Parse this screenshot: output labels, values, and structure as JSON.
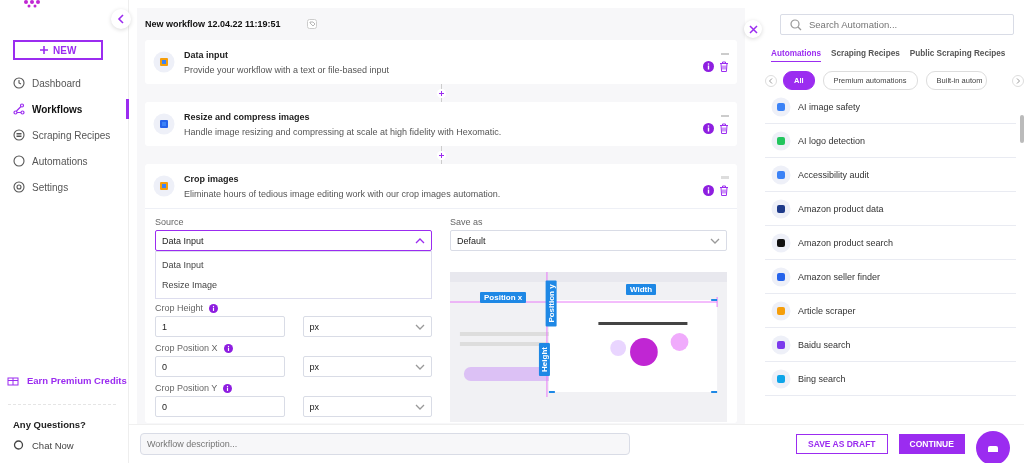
{
  "sidebar": {
    "new_button": "NEW",
    "nav": [
      {
        "label": "Dashboard",
        "selected": false
      },
      {
        "label": "Workflows",
        "selected": true
      },
      {
        "label": "Scraping Recipes",
        "selected": false
      },
      {
        "label": "Automations",
        "selected": false
      },
      {
        "label": "Settings",
        "selected": false
      }
    ],
    "earn_credits": "Earn Premium Credits",
    "questions_title": "Any Questions?",
    "chat_now": "Chat Now"
  },
  "workflow": {
    "title": "New workflow 12.04.22 11:19:51",
    "steps": [
      {
        "title": "Data input",
        "description": "Provide your workflow with a text or file-based input",
        "expanded": false
      },
      {
        "title": "Resize and compress images",
        "description": "Handle image resizing and compressing at scale at high fidelity with Hexomatic.",
        "expanded": false
      },
      {
        "title": "Crop images",
        "description": "Eliminate hours of tedious image editing work with our crop images automation.",
        "expanded": true
      }
    ]
  },
  "form": {
    "source": {
      "label": "Source",
      "value": "Data Input",
      "open": true,
      "options": [
        "Data Input",
        "Resize Image"
      ]
    },
    "save_as": {
      "label": "Save as",
      "value": "Default"
    },
    "fields": [
      {
        "label": "Crop Height",
        "value": "1",
        "unit": "px"
      },
      {
        "label": "Crop Position X",
        "value": "0",
        "unit": "px"
      },
      {
        "label": "Crop Position Y",
        "value": "0",
        "unit": "px"
      }
    ],
    "preview": {
      "kind": "picture",
      "labels": [
        "Position x",
        "Position y",
        "Width",
        "Height"
      ]
    }
  },
  "panel": {
    "search": {
      "placeholder": "Search Automation..."
    },
    "tabs": [
      {
        "label": "Automations",
        "selected": true
      },
      {
        "label": "Scraping Recipes",
        "selected": false
      },
      {
        "label": "Public Scraping Recipes",
        "selected": false
      }
    ],
    "chips": [
      {
        "label": "All",
        "selected": true
      },
      {
        "label": "Premium automations",
        "selected": false
      },
      {
        "label": "Built-in autom",
        "selected": false
      }
    ],
    "items": [
      {
        "name": "AI image safety"
      },
      {
        "name": "AI logo detection"
      },
      {
        "name": "Accessibility audit"
      },
      {
        "name": "Amazon product data"
      },
      {
        "name": "Amazon product search"
      },
      {
        "name": "Amazon seller finder"
      },
      {
        "name": "Article scraper"
      },
      {
        "name": "Baidu search"
      },
      {
        "name": "Bing search"
      }
    ]
  },
  "bottom": {
    "description": {
      "placeholder": "Workflow description..."
    },
    "save_draft": "SAVE AS DRAFT",
    "continue": "CONTINUE"
  }
}
